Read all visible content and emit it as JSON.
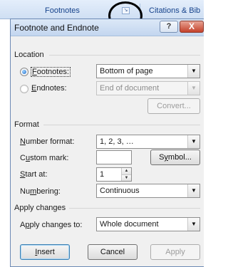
{
  "ribbon": {
    "footnotes_group": "Footnotes",
    "citations_group": "Citations & Bib",
    "launcher_icon": "dialog-launcher-icon"
  },
  "dialog": {
    "title": "Footnote and Endnote",
    "help_label": "?",
    "close_label": "X"
  },
  "location": {
    "heading": "Location",
    "footnotes_label": "Footnotes:",
    "footnotes_selected": true,
    "footnotes_value": "Bottom of page",
    "endnotes_label": "Endnotes:",
    "endnotes_value": "End of document",
    "convert_label": "Convert..."
  },
  "format": {
    "heading": "Format",
    "number_format_label": "Number format:",
    "number_format_value": "1, 2, 3, …",
    "custom_mark_label": "Custom mark:",
    "custom_mark_value": "",
    "symbol_label": "Symbol...",
    "start_at_label": "Start at:",
    "start_at_value": "1",
    "numbering_label": "Numbering:",
    "numbering_value": "Continuous"
  },
  "apply": {
    "heading": "Apply changes",
    "apply_to_label": "Apply changes to:",
    "apply_to_value": "Whole document"
  },
  "buttons": {
    "insert": "Insert",
    "cancel": "Cancel",
    "apply": "Apply"
  }
}
